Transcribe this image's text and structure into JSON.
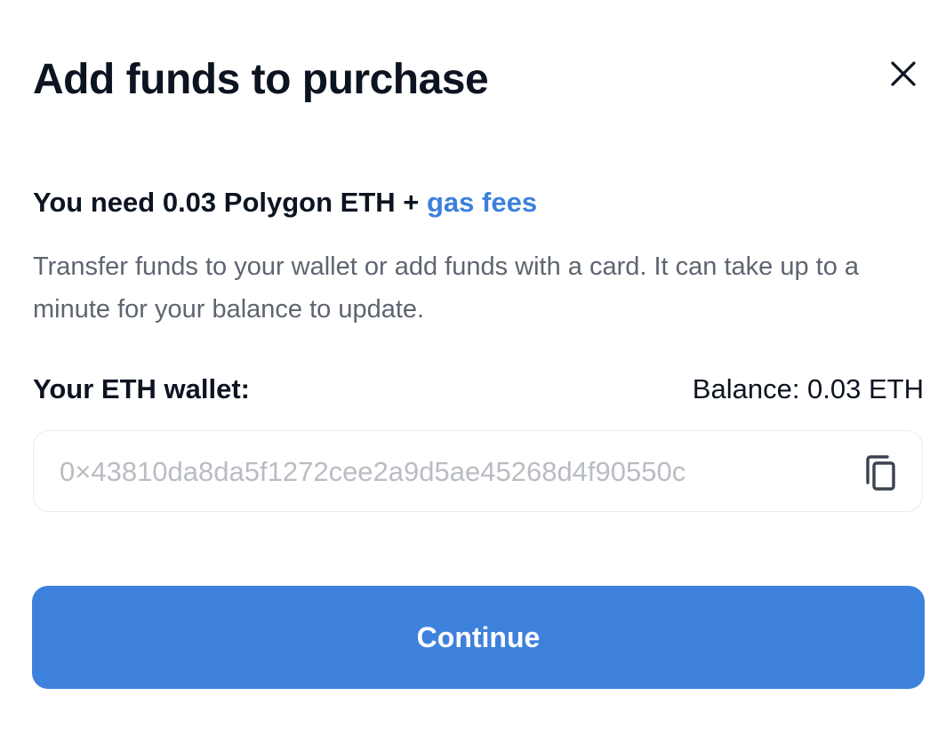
{
  "modal": {
    "title": "Add funds to purchase",
    "close_icon": "close-icon"
  },
  "requirement": {
    "prefix": "You need 0.03 Polygon ETH + ",
    "link_text": "gas fees",
    "link_color": "#3c80dc"
  },
  "description": "Transfer funds to your wallet or add funds with a card. It can take up to a minute for your balance to update.",
  "wallet": {
    "label": "Your ETH wallet:",
    "balance": "Balance: 0.03 ETH",
    "address": "0×43810da8da5f1272cee2a9d5ae45268d4f90550c",
    "copy_icon": "copy-icon"
  },
  "actions": {
    "continue_label": "Continue",
    "accent_color": "#3e81dc"
  }
}
